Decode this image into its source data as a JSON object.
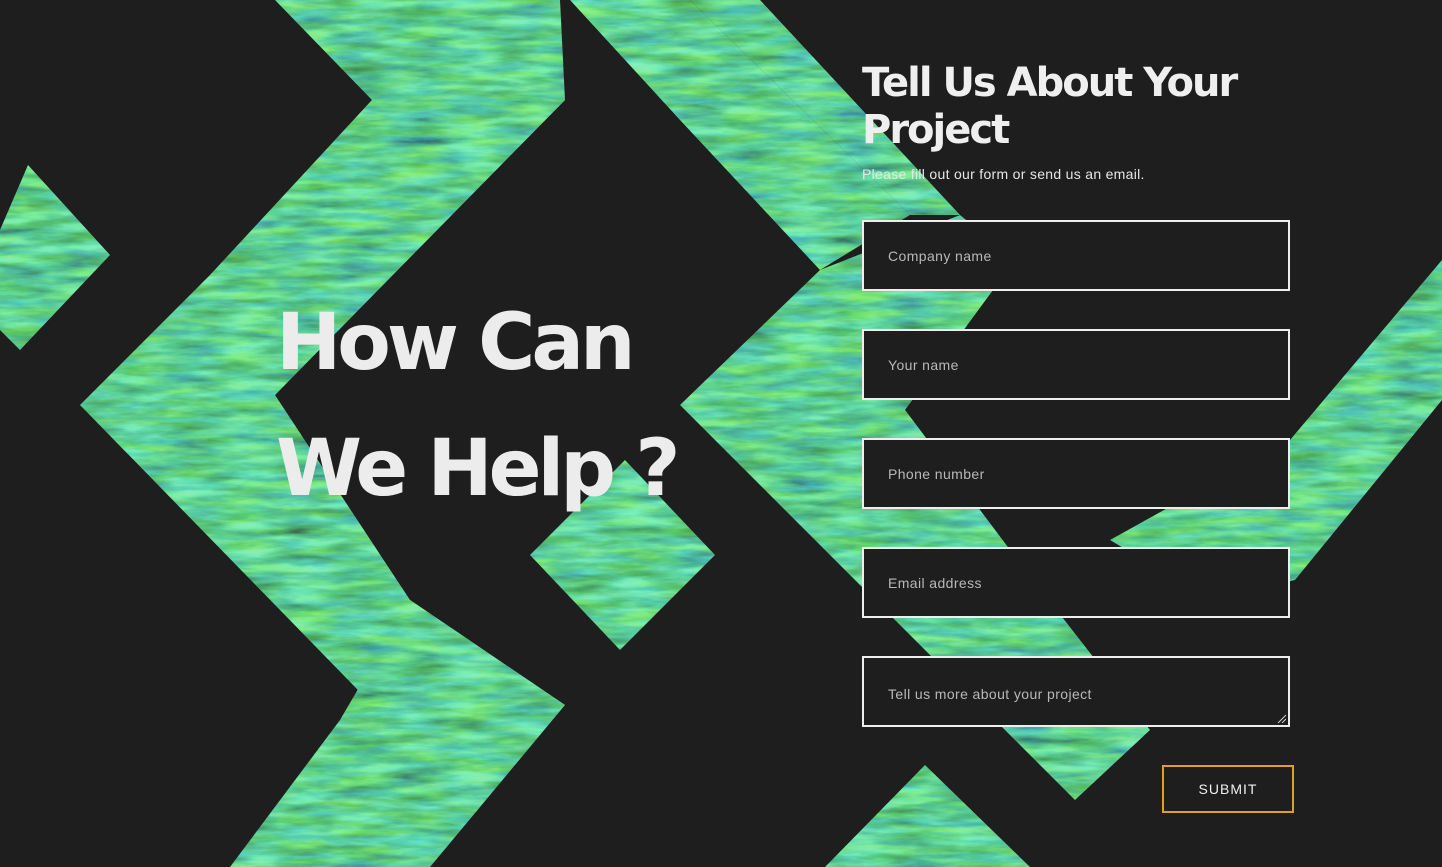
{
  "hero": {
    "line1": "How Can",
    "line2": "We Help ?"
  },
  "form": {
    "title": "Tell Us About Your Project",
    "subtitle": "Please fill out our form or send us an email.",
    "company_placeholder": "Company name",
    "name_placeholder": "Your name",
    "phone_placeholder": "Phone number",
    "email_placeholder": "Email address",
    "project_placeholder": "Tell us more about your project",
    "submit_label": "SUBMIT"
  },
  "colors": {
    "background": "#1e1e1e",
    "text": "#ececec",
    "field_border": "#eeeeee",
    "submit_border": "#e0a020",
    "pattern_dark": "#0a2418",
    "pattern_green": "#4fa83a",
    "pattern_teal": "#1f9aa6",
    "pattern_lime": "#9ccf4a"
  }
}
